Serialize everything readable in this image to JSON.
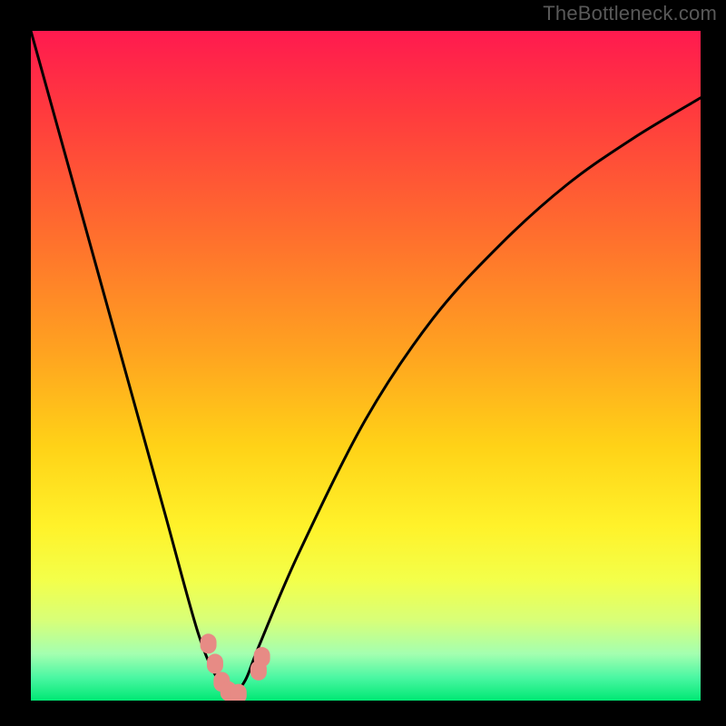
{
  "attribution": "TheBottleneck.com",
  "chart_data": {
    "type": "line",
    "title": "",
    "xlabel": "",
    "ylabel": "",
    "xlim": [
      0,
      100
    ],
    "ylim": [
      0,
      100
    ],
    "grid": false,
    "legend": false,
    "series": [
      {
        "name": "bottleneck-curve",
        "x": [
          0,
          5,
          10,
          15,
          20,
          25,
          28,
          30,
          32,
          34,
          40,
          50,
          60,
          70,
          80,
          90,
          100
        ],
        "y": [
          100,
          82,
          64,
          46,
          28,
          10,
          3,
          1,
          3,
          8,
          22,
          42,
          57,
          68,
          77,
          84,
          90
        ]
      }
    ],
    "bottleneck_zero_range_x": [
      28,
      32
    ],
    "markers": {
      "name": "measured-points",
      "points": [
        {
          "x": 26.5,
          "y": 8.5
        },
        {
          "x": 27.5,
          "y": 5.5
        },
        {
          "x": 28.5,
          "y": 2.8
        },
        {
          "x": 29.5,
          "y": 1.4
        },
        {
          "x": 31.0,
          "y": 1.0
        },
        {
          "x": 34.0,
          "y": 4.5
        },
        {
          "x": 34.5,
          "y": 6.5
        }
      ]
    },
    "gradient_stops": [
      {
        "offset": 0.0,
        "color": "#ff1a4f"
      },
      {
        "offset": 0.12,
        "color": "#ff3a3e"
      },
      {
        "offset": 0.3,
        "color": "#ff6d2e"
      },
      {
        "offset": 0.48,
        "color": "#ffa320"
      },
      {
        "offset": 0.62,
        "color": "#ffd217"
      },
      {
        "offset": 0.74,
        "color": "#fff22a"
      },
      {
        "offset": 0.82,
        "color": "#f3ff4a"
      },
      {
        "offset": 0.88,
        "color": "#d8ff78"
      },
      {
        "offset": 0.93,
        "color": "#a4ffb0"
      },
      {
        "offset": 0.965,
        "color": "#4cf7a3"
      },
      {
        "offset": 1.0,
        "color": "#00e874"
      }
    ]
  }
}
